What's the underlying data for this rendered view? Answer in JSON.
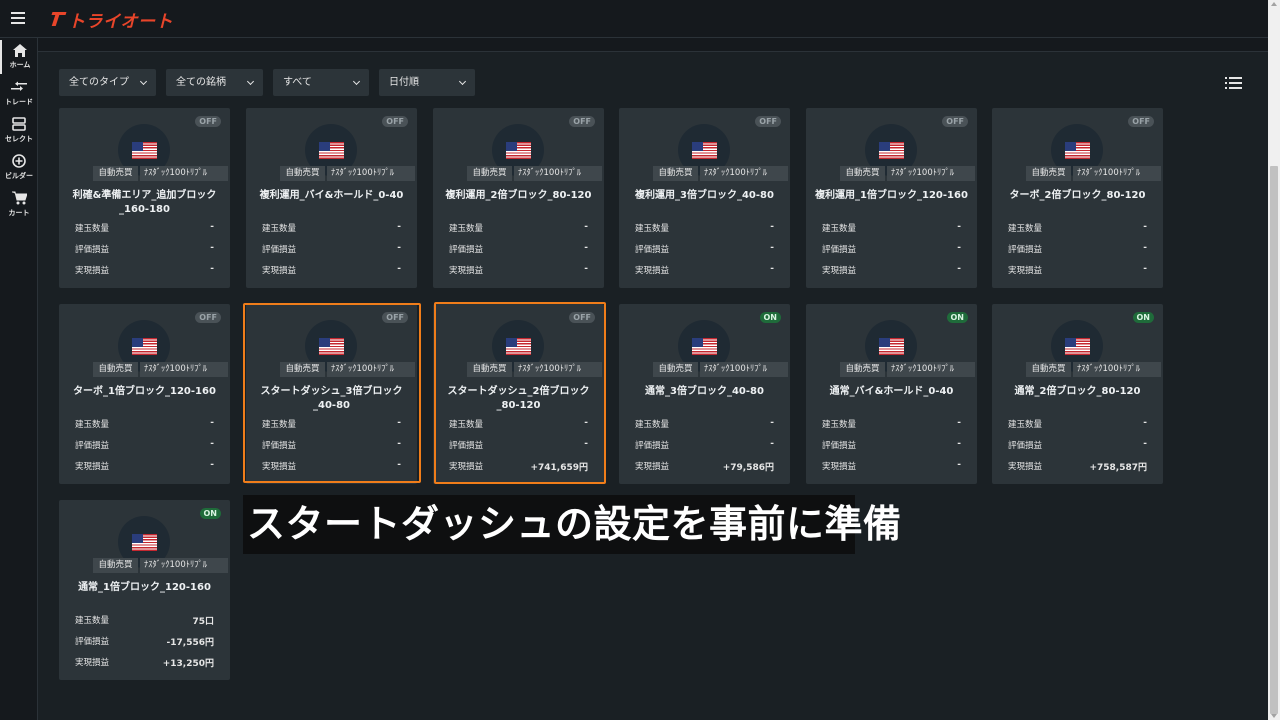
{
  "app": {
    "logo_text": "トライオート"
  },
  "nav": [
    {
      "label": "ホーム",
      "icon": "home-icon"
    },
    {
      "label": "トレード",
      "icon": "trade-icon"
    },
    {
      "label": "セレクト",
      "icon": "select-icon"
    },
    {
      "label": "ビルダー",
      "icon": "builder-icon"
    },
    {
      "label": "カート",
      "icon": "cart-icon"
    }
  ],
  "filters": [
    {
      "label": "全てのタイプ"
    },
    {
      "label": "全ての銘柄"
    },
    {
      "label": "すべて"
    },
    {
      "label": "日付順"
    }
  ],
  "stat_labels": {
    "quantity": "建玉数量",
    "unrealized": "評価損益",
    "realized": "実現損益"
  },
  "cards": [
    {
      "status": "OFF",
      "tag1": "自動売買",
      "tag2": "ﾅｽﾀﾞｯｸ100ﾄﾘﾌﾟﾙ",
      "name": "利確&準備エリア_追加ブロック_160-180",
      "quantity": "-",
      "unrealized": "-",
      "realized": "-"
    },
    {
      "status": "OFF",
      "tag1": "自動売買",
      "tag2": "ﾅｽﾀﾞｯｸ100ﾄﾘﾌﾟﾙ",
      "name": "複利運用_バイ&ホールド_0-40",
      "quantity": "-",
      "unrealized": "-",
      "realized": "-"
    },
    {
      "status": "OFF",
      "tag1": "自動売買",
      "tag2": "ﾅｽﾀﾞｯｸ100ﾄﾘﾌﾟﾙ",
      "name": "複利運用_2倍ブロック_80-120",
      "quantity": "-",
      "unrealized": "-",
      "realized": "-"
    },
    {
      "status": "OFF",
      "tag1": "自動売買",
      "tag2": "ﾅｽﾀﾞｯｸ100ﾄﾘﾌﾟﾙ",
      "name": "複利運用_3倍ブロック_40-80",
      "quantity": "-",
      "unrealized": "-",
      "realized": "-"
    },
    {
      "status": "OFF",
      "tag1": "自動売買",
      "tag2": "ﾅｽﾀﾞｯｸ100ﾄﾘﾌﾟﾙ",
      "name": "複利運用_1倍ブロック_120-160",
      "quantity": "-",
      "unrealized": "-",
      "realized": "-"
    },
    {
      "status": "OFF",
      "tag1": "自動売買",
      "tag2": "ﾅｽﾀﾞｯｸ100ﾄﾘﾌﾟﾙ",
      "name": "ターボ_2倍ブロック_80-120",
      "quantity": "-",
      "unrealized": "-",
      "realized": "-"
    },
    {
      "status": "OFF",
      "tag1": "自動売買",
      "tag2": "ﾅｽﾀﾞｯｸ100ﾄﾘﾌﾟﾙ",
      "name": "ターボ_1倍ブロック_120-160",
      "quantity": "-",
      "unrealized": "-",
      "realized": "-"
    },
    {
      "status": "OFF",
      "tag1": "自動売買",
      "tag2": "ﾅｽﾀﾞｯｸ100ﾄﾘﾌﾟﾙ",
      "name": "スタートダッシュ_3倍ブロック_40-80",
      "quantity": "-",
      "unrealized": "-",
      "realized": "-"
    },
    {
      "status": "OFF",
      "tag1": "自動売買",
      "tag2": "ﾅｽﾀﾞｯｸ100ﾄﾘﾌﾟﾙ",
      "name": "スタートダッシュ_2倍ブロック_80-120",
      "quantity": "-",
      "unrealized": "-",
      "realized": "+741,659円"
    },
    {
      "status": "ON",
      "tag1": "自動売買",
      "tag2": "ﾅｽﾀﾞｯｸ100ﾄﾘﾌﾟﾙ",
      "name": "通常_3倍ブロック_40-80",
      "quantity": "-",
      "unrealized": "-",
      "realized": "+79,586円"
    },
    {
      "status": "ON",
      "tag1": "自動売買",
      "tag2": "ﾅｽﾀﾞｯｸ100ﾄﾘﾌﾟﾙ",
      "name": "通常_バイ&ホールド_0-40",
      "quantity": "-",
      "unrealized": "-",
      "realized": "-"
    },
    {
      "status": "ON",
      "tag1": "自動売買",
      "tag2": "ﾅｽﾀﾞｯｸ100ﾄﾘﾌﾟﾙ",
      "name": "通常_2倍ブロック_80-120",
      "quantity": "-",
      "unrealized": "-",
      "realized": "+758,587円"
    },
    {
      "status": "ON",
      "tag1": "自動売買",
      "tag2": "ﾅｽﾀﾞｯｸ100ﾄﾘﾌﾟﾙ",
      "name": "通常_1倍ブロック_120-160",
      "quantity": "75口",
      "unrealized": "-17,556円",
      "realized": "+13,250円"
    }
  ],
  "caption": "スタートダッシュの設定を事前に準備",
  "colors": {
    "accent": "#e8452a",
    "highlight": "#f07d1a",
    "on": "#1f6b3a",
    "off": "#4a5257"
  }
}
